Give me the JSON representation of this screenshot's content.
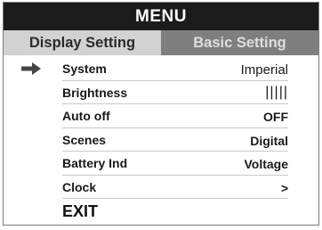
{
  "menu": {
    "title": "MENU"
  },
  "tabs": [
    {
      "label": "Display Setting",
      "active": true
    },
    {
      "label": "Basic Setting",
      "active": false
    }
  ],
  "settings": [
    {
      "label": "System",
      "value": "Imperial",
      "selected": true
    },
    {
      "label": "Brightness",
      "value": "|||||",
      "selected": false
    },
    {
      "label": "Auto off",
      "value": "OFF",
      "selected": false
    },
    {
      "label": "Scenes",
      "value": "Digital",
      "selected": false
    },
    {
      "label": "Battery Ind",
      "value": "Voltage",
      "selected": false
    },
    {
      "label": "Clock",
      "value": ">",
      "selected": false
    }
  ],
  "exit_label": "EXIT",
  "icons": {
    "selection": "right-arrow-icon"
  },
  "colors": {
    "title_bg": "#1b1b1b",
    "active_tab_bg": "#d2d2d2",
    "inactive_tab_bg": "#7f7f7f",
    "arrow": "#444444"
  }
}
